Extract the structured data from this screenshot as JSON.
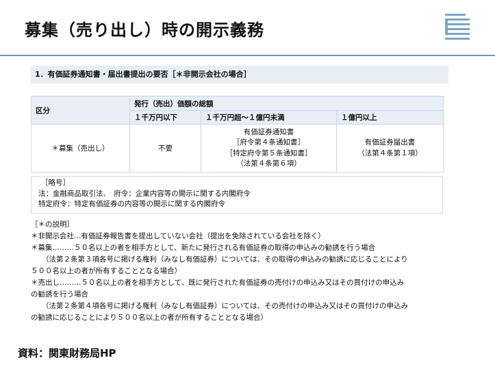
{
  "slide": {
    "title": "募集（売り出し）時の開示義務",
    "source": "資料：関東財務局HP"
  },
  "section": {
    "heading": "1．有価証券通知書・届出書提出の要否［＊非開示会社の場合］"
  },
  "table": {
    "col_label": "区分",
    "group_header": "発行（売出）価額の総額",
    "columns": [
      "１千万円以下",
      "１千万円超～１億円未満",
      "１億円以上"
    ],
    "row_label": "＊募集（売出し）",
    "cells": {
      "c1": "不要",
      "c2": [
        "有価証券通知書",
        "［府令第４条通知書］",
        "［特定府令第５条通知書］",
        "（法第４条第６項）"
      ],
      "c3": [
        "有価証券届出書",
        "（法第４条第１項）"
      ]
    }
  },
  "legend": {
    "title": "［略号］",
    "line1": "法：金融商品取引法、　府令：企業内容等の開示に関する内閣府令",
    "line2": "特定府令：特定有価証券の内容等の開示に関する内閣府令"
  },
  "notes": {
    "title": "［＊の説明］",
    "lines": [
      "＊非開示会社…有価証券報告書を提出していない会社（提出を免除されている会社を除く）",
      "＊募集………５０名以上の者を相手方として、新たに発行される有価証券の取得の申込みの勧誘を行う場合",
      "（法第２条第３項各号に掲げる権利（みなし有価証券）については、その取得の申込みの勧誘に応じることにより",
      "５００名以上の者が所有することとなる場合）",
      "＊売出し………５０名以上の者を相手方として、既に発行された有価証券の売付けの申込み又はその買付けの申込み",
      "の勧誘を行う場合",
      "（法第２条第４項各号に掲げる権利（みなし有価証券）については、その売付けの申込み又はその買付けの申込み",
      "の勧誘に応じることにより５００名以上の者が所有することとなる場合）"
    ]
  },
  "colors": {
    "accent": "#6d96b4",
    "header_bg": "#e7eef6",
    "border": "#c9d7e6"
  },
  "icons": {
    "logo": "bureau-logo-icon"
  }
}
